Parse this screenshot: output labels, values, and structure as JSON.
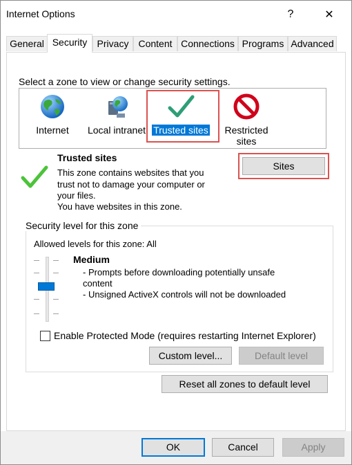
{
  "window": {
    "title": "Internet Options",
    "help_glyph": "?",
    "close_glyph": "✕"
  },
  "tabs": [
    {
      "label": "General"
    },
    {
      "label": "Security"
    },
    {
      "label": "Privacy"
    },
    {
      "label": "Content"
    },
    {
      "label": "Connections"
    },
    {
      "label": "Programs"
    },
    {
      "label": "Advanced"
    }
  ],
  "active_tab": "Security",
  "zones": {
    "instruction": "Select a zone to view or change security settings.",
    "items": [
      {
        "label": "Internet",
        "icon": "globe-icon"
      },
      {
        "label": "Local intranet",
        "icon": "intranet-icon"
      },
      {
        "label": "Trusted sites",
        "icon": "checkmark-icon",
        "selected": true
      },
      {
        "label_line1": "Restricted",
        "label_line2": "sites",
        "icon": "restricted-icon"
      }
    ]
  },
  "zone_info": {
    "title": "Trusted sites",
    "line1": "This zone contains websites that you",
    "line2": "trust not to damage your computer or",
    "line3": "your files.",
    "line4": "You have websites in this zone.",
    "sites_button": "Sites"
  },
  "security_level": {
    "group_title": "Security level for this zone",
    "allowed": "Allowed levels for this zone: All",
    "level_name": "Medium",
    "bullet1_line1": "- Prompts before downloading potentially unsafe",
    "bullet1_line2": "content",
    "bullet2": "- Unsigned ActiveX controls will not be downloaded",
    "slider_level": "Medium"
  },
  "protected_mode": {
    "label": "Enable Protected Mode (requires restarting Internet Explorer)",
    "checked": false
  },
  "buttons": {
    "custom_level": "Custom level...",
    "default_level": "Default level",
    "reset_all": "Reset all zones to default level",
    "ok": "OK",
    "cancel": "Cancel",
    "apply": "Apply"
  },
  "colors": {
    "selection": "#0078d7",
    "highlight_box": "#d9534f",
    "check_green": "#3ab54a",
    "restricted_red": "#d0021b"
  }
}
